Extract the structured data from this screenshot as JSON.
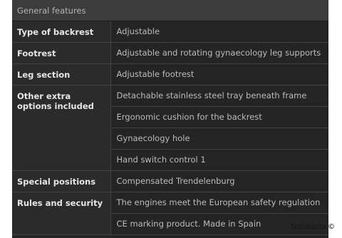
{
  "header": {
    "title": "General features"
  },
  "rows": [
    {
      "label": "Type of backrest",
      "values": [
        "Adjustable"
      ]
    },
    {
      "label": "Footrest",
      "values": [
        "Adjustable and rotating gynaecology leg supports"
      ]
    },
    {
      "label": "Leg section",
      "values": [
        "Adjustable footrest"
      ]
    },
    {
      "label": "Other extra options included",
      "values": [
        "Detachable stainless steel tray beneath frame",
        "Ergonomic cushion for the backrest",
        "Gynaecology hole",
        "Hand switch control 1"
      ]
    },
    {
      "label": "Special positions",
      "values": [
        "Compensated Trendelenburg"
      ]
    },
    {
      "label": "Rules and security",
      "values": [
        "The engines meet the European safety regulation",
        "CE marking product. Made in Spain"
      ]
    }
  ],
  "watermark": {
    "text": "Neurovita",
    "symbol": "©"
  },
  "colors": {
    "header_bg": "#3c3c3c",
    "table_bg": "#242424",
    "label_bg": "#2b2b2b",
    "border": "#444444"
  }
}
